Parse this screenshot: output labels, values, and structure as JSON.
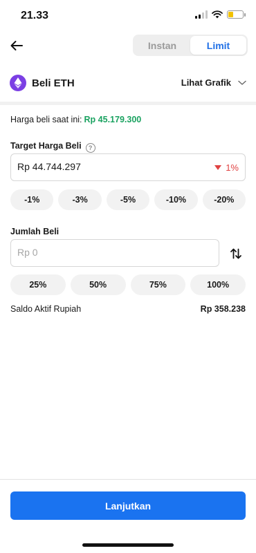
{
  "status": {
    "time": "21.33"
  },
  "header": {
    "tabs": [
      {
        "label": "Instan",
        "active": false
      },
      {
        "label": "Limit",
        "active": true
      }
    ]
  },
  "asset": {
    "title": "Beli ETH",
    "chart_link": "Lihat Grafik",
    "icon": "ethereum-icon",
    "color": "#7b3fe4"
  },
  "current_price": {
    "label": "Harga beli saat ini:",
    "value": "Rp 45.179.300"
  },
  "target": {
    "label": "Target Harga Beli",
    "value": "Rp 44.744.297",
    "change": "1%",
    "chips": [
      "-1%",
      "-3%",
      "-5%",
      "-10%",
      "-20%"
    ]
  },
  "amount": {
    "label": "Jumlah Beli",
    "placeholder": "Rp 0",
    "chips": [
      "25%",
      "50%",
      "75%",
      "100%"
    ]
  },
  "balance": {
    "label": "Saldo Aktif Rupiah",
    "value": "Rp 358.238"
  },
  "cta": {
    "label": "Lanjutkan",
    "color": "#1a73f0"
  }
}
